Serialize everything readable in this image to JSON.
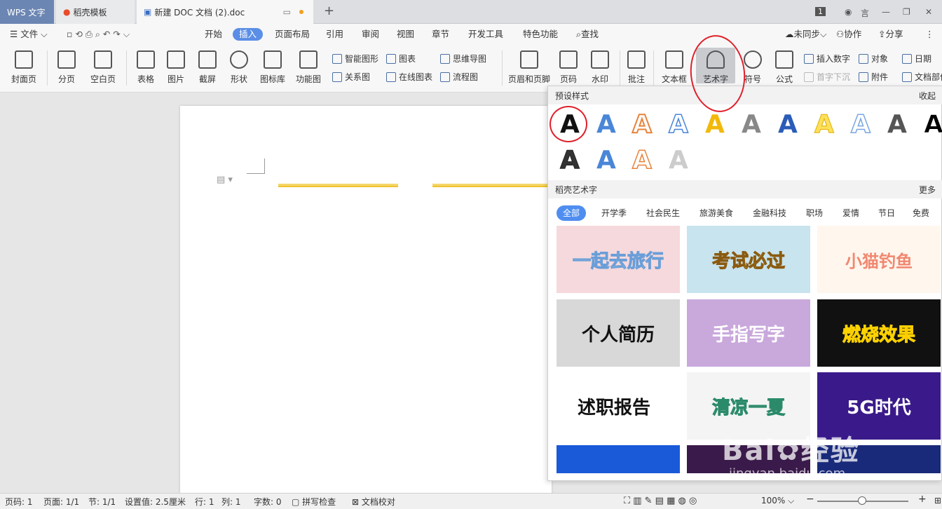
{
  "tabs": {
    "app": "WPS 文字",
    "template": "稻壳模板",
    "doc": "新建 DOC 文档 (2).doc",
    "count": "1",
    "user": "言"
  },
  "menu": {
    "file": "文件",
    "items": [
      "开始",
      "插入",
      "页面布局",
      "引用",
      "审阅",
      "视图",
      "章节",
      "开发工具",
      "特色功能"
    ],
    "search": "查找",
    "sync": "未同步",
    "collab": "协作",
    "share": "分享"
  },
  "ribbon": {
    "big": [
      "封面页",
      "分页",
      "空白页",
      "表格",
      "图片",
      "截屏",
      "形状",
      "图标库",
      "功能图",
      "页眉和页脚",
      "页码",
      "水印",
      "批注",
      "文本框",
      "艺术字",
      "符号",
      "公式"
    ],
    "small": [
      "智能图形",
      "关系图",
      "图表",
      "在线图表",
      "思维导图",
      "流程图",
      "插入数字",
      "首字下沉",
      "对象",
      "附件",
      "日期",
      "文档部件"
    ]
  },
  "panel": {
    "preset_title": "预设样式",
    "collapse": "收起",
    "glyph": "A",
    "daoke_title": "稻壳艺术字",
    "more": "更多",
    "categories": [
      "全部",
      "开学季",
      "社会民生",
      "旅游美食",
      "金融科技",
      "职场",
      "爱情",
      "节日",
      "免费"
    ],
    "thumbs": [
      "一起去旅行",
      "考试必过",
      "小猫钓鱼",
      "个人简历",
      "手指写字",
      "燃烧效果",
      "述职报告",
      "清凉一夏",
      "5G时代"
    ]
  },
  "status": {
    "page": "页码: 1",
    "pages": "页面: 1/1",
    "section": "节: 1/1",
    "setting": "设置值: 2.5厘米",
    "row": "行: 1",
    "col": "列: 1",
    "words": "字数: 0",
    "spell": "拼写检查",
    "proof": "文档校对",
    "zoom": "100%"
  },
  "watermark": {
    "brand": "Bai",
    "sub": "经验",
    "url": "jingyan.baidu.com"
  }
}
